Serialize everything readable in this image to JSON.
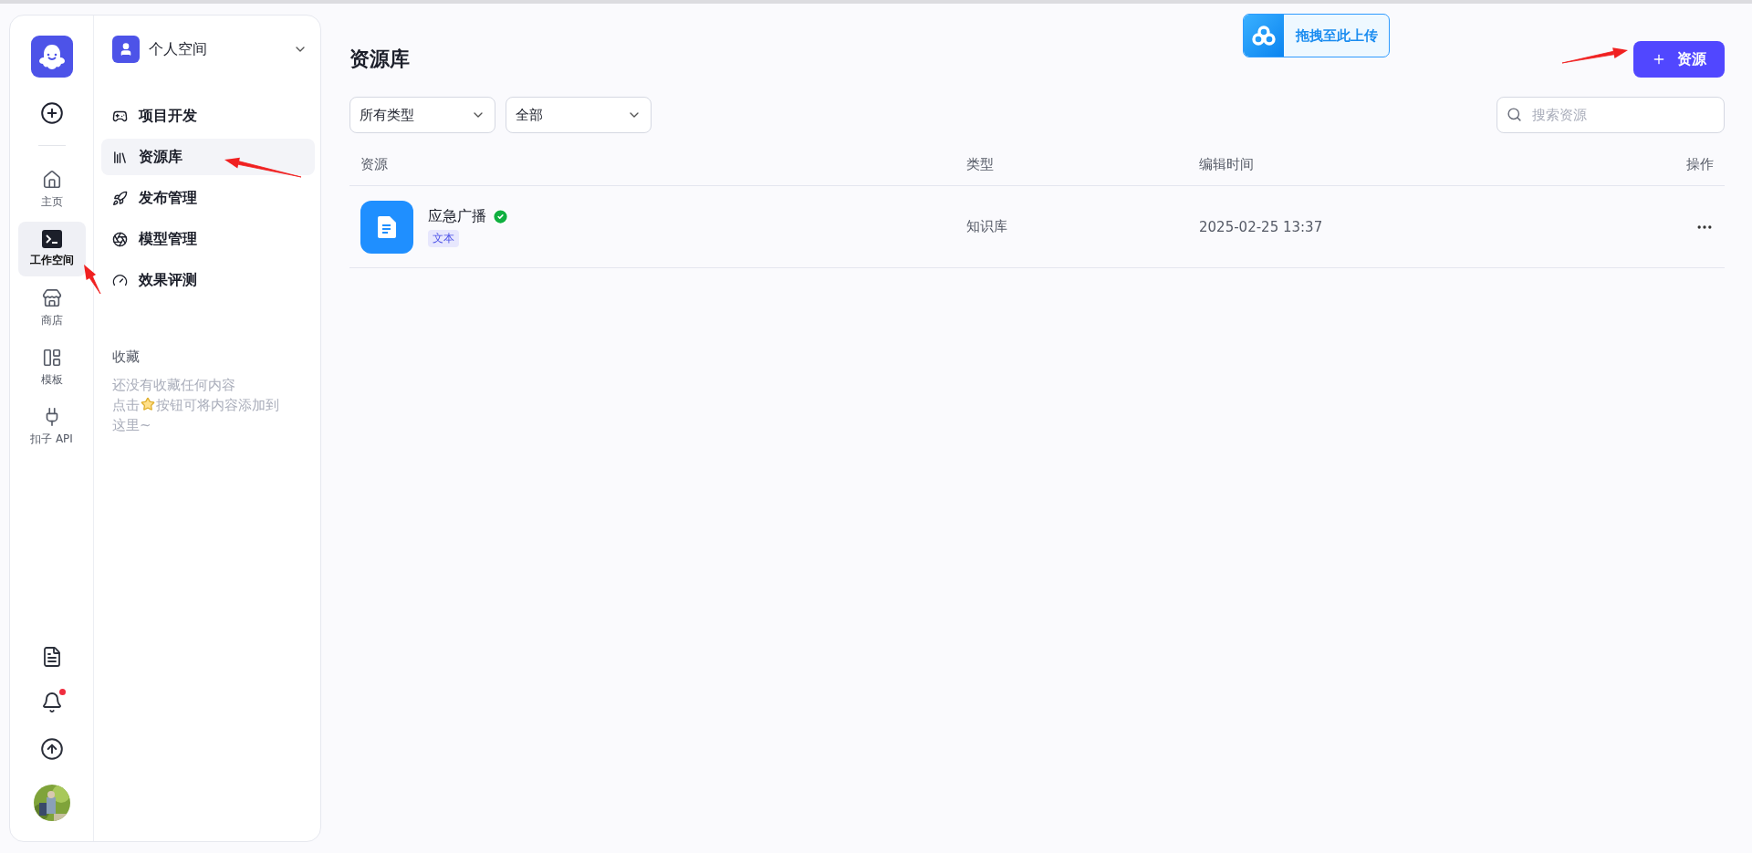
{
  "rail": {
    "items": [
      {
        "label": "主页",
        "selected": false
      },
      {
        "label": "工作空间",
        "selected": true
      },
      {
        "label": "商店",
        "selected": false
      },
      {
        "label": "模板",
        "selected": false
      },
      {
        "label": "扣子 API",
        "selected": false
      }
    ],
    "notifications_unread": true
  },
  "space": {
    "name": "个人空间"
  },
  "menu": [
    {
      "label": "项目开发",
      "selected": false
    },
    {
      "label": "资源库",
      "selected": true
    },
    {
      "label": "发布管理",
      "selected": false
    },
    {
      "label": "模型管理",
      "selected": false
    },
    {
      "label": "效果评测",
      "selected": false
    }
  ],
  "favorites": {
    "title": "收藏",
    "empty": "还没有收藏任何内容",
    "hint_before": "点击",
    "hint_after": "按钮可将内容添加到",
    "hint_end": "这里~"
  },
  "upload_widget": {
    "label": "拖拽至此上传"
  },
  "page": {
    "title": "资源库",
    "add_button": "资源"
  },
  "filters": [
    {
      "value": "所有类型"
    },
    {
      "value": "全部"
    }
  ],
  "search": {
    "placeholder": "搜索资源"
  },
  "table": {
    "columns": [
      "资源",
      "类型",
      "编辑时间",
      "操作"
    ],
    "rows": [
      {
        "name": "应急广播",
        "verified": true,
        "tag": "文本",
        "type": "知识库",
        "edited": "2025-02-25 13:37"
      }
    ]
  },
  "annotations": [
    {
      "kind": "arrow"
    },
    {
      "kind": "arrow"
    },
    {
      "kind": "arrow"
    }
  ]
}
